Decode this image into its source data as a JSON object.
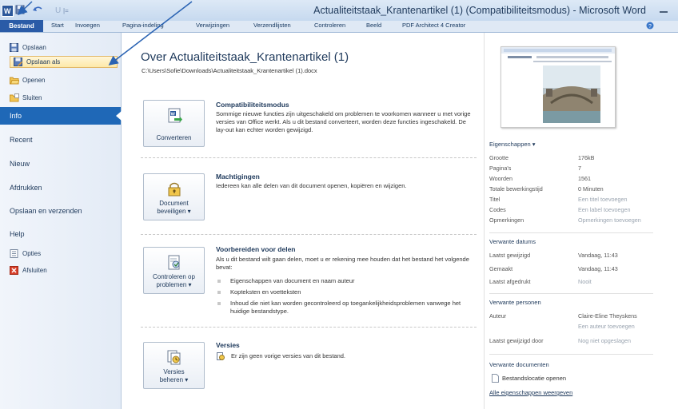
{
  "window": {
    "title": "Actualiteitstaak_Krantenartikel (1) (Compatibiliteitsmodus) - Microsoft Word"
  },
  "ribbon_tabs": [
    "Bestand",
    "Start",
    "Invoegen",
    "Pagina-indeling",
    "Verwijzingen",
    "Verzendlijsten",
    "Controleren",
    "Beeld",
    "PDF Architect 4 Creator"
  ],
  "file_commands": [
    "Opslaan",
    "Opslaan als",
    "Openen",
    "Sluiten"
  ],
  "nav_items": [
    "Info",
    "Recent",
    "Nieuw",
    "Afdrukken",
    "Opslaan en verzenden",
    "Help"
  ],
  "bottom_commands": [
    "Opties",
    "Afsluiten"
  ],
  "main": {
    "title": "Over Actualiteitstaak_Krantenartikel (1)",
    "path": "C:\\Users\\Sofie\\Downloads\\Actualiteitstaak_Krantenartikel (1).docx",
    "sections": {
      "compat": {
        "button": "Converteren",
        "title": "Compatibiliteitsmodus",
        "text": "Sommige nieuwe functies zijn uitgeschakeld om problemen te voorkomen wanneer u met vorige versies van Office werkt. Als u dit bestand converteert, worden deze functies ingeschakeld. De lay-out kan echter worden gewijzigd."
      },
      "permissions": {
        "button_line1": "Document",
        "button_line2": "beveiligen ▾",
        "title": "Machtigingen",
        "text": "Iedereen kan alle delen van dit document openen, kopiëren en wijzigen."
      },
      "prepare": {
        "button_line1": "Controleren op",
        "button_line2": "problemen ▾",
        "title": "Voorbereiden voor delen",
        "text": "Als u dit bestand wilt gaan delen, moet u er rekening mee houden dat het bestand het volgende bevat:",
        "bullets": [
          "Eigenschappen van document en naam auteur",
          "Kopteksten en voetteksten",
          "Inhoud die niet kan worden gecontroleerd op toegankelijkheidsproblemen vanwege het huidige bestandstype."
        ]
      },
      "versions": {
        "button_line1": "Versies",
        "button_line2": "beheren ▾",
        "title": "Versies",
        "text": "Er zijn geen vorige versies van dit bestand."
      }
    }
  },
  "properties": {
    "heading": "Eigenschappen ▾",
    "rows": [
      {
        "key": "Grootte",
        "value": "176kB"
      },
      {
        "key": "Pagina's",
        "value": "7"
      },
      {
        "key": "Woorden",
        "value": "1561"
      },
      {
        "key": "Totale bewerkingstijd",
        "value": "0 Minuten"
      },
      {
        "key": "Titel",
        "value": "Een titel toevoegen"
      },
      {
        "key": "Codes",
        "value": "Een label toevoegen"
      },
      {
        "key": "Opmerkingen",
        "value": "Opmerkingen toevoegen"
      }
    ]
  },
  "dates": {
    "heading": "Verwante datums",
    "rows": [
      {
        "key": "Laatst gewijzigd",
        "value": "Vandaag, 11:43"
      },
      {
        "key": "Gemaakt",
        "value": "Vandaag, 11:43"
      },
      {
        "key": "Laatst afgedrukt",
        "value": "Nooit"
      }
    ]
  },
  "people": {
    "heading": "Verwante personen",
    "author_key": "Auteur",
    "author": "Claire-Eline Theyskens",
    "add_author": "Een auteur toevoegen",
    "last_saved_key": "Laatst gewijzigd door",
    "last_saved": "Nog niet opgeslagen"
  },
  "documents": {
    "heading": "Verwante documenten",
    "location": "Bestandslocatie openen",
    "all_props": "Alle eigenschappen weergeven"
  },
  "colors": {
    "accent": "#1f68b7",
    "file_tab": "#2a5ba7",
    "arrow": "#2a63b3"
  }
}
